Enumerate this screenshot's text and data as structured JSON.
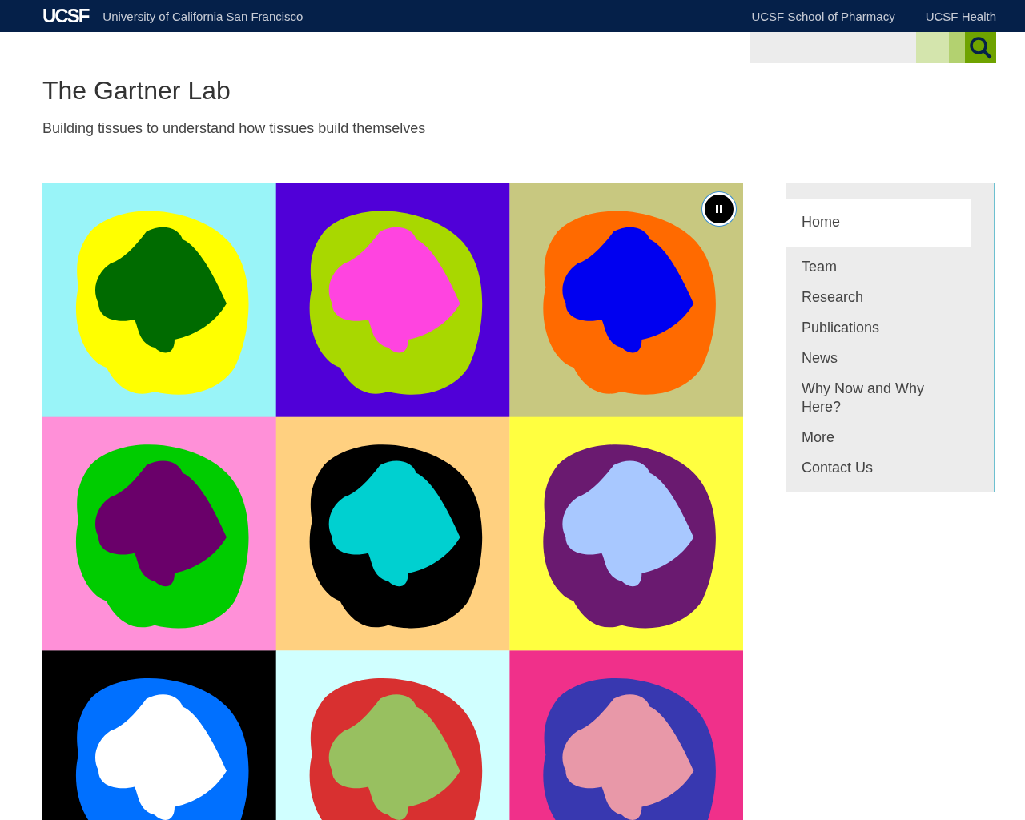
{
  "header": {
    "logo": "UCSF",
    "university": "University of California San Francisco",
    "links": [
      "UCSF School of Pharmacy",
      "UCSF Health"
    ]
  },
  "site": {
    "title": "The Gartner Lab",
    "tagline": "Building tissues to understand how tissues build themselves"
  },
  "slideshow": {
    "paused": false
  },
  "nav": [
    {
      "label": "Home",
      "selected": true
    },
    {
      "label": "Team",
      "selected": false
    },
    {
      "label": "Research",
      "selected": false
    },
    {
      "label": "Publications",
      "selected": false
    },
    {
      "label": "News",
      "selected": false
    },
    {
      "label": "Why Now and Why Here?",
      "selected": false
    },
    {
      "label": "More",
      "selected": false
    },
    {
      "label": "Contact Us",
      "selected": false
    }
  ]
}
